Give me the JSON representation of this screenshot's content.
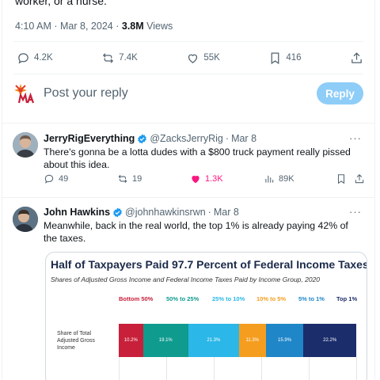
{
  "tweet": {
    "text_tail": "worker, or a nurse.",
    "time": "4:10 AM",
    "date": "Mar 8, 2024",
    "views_count": "3.8M",
    "views_label": "Views",
    "stats": {
      "replies": "4.2K",
      "retweets": "7.4K",
      "likes": "55K",
      "bookmarks": "416"
    }
  },
  "compose": {
    "placeholder": "Post your reply",
    "reply_button": "Reply"
  },
  "replies": [
    {
      "name": "JerryRigEverything",
      "handle": "@ZacksJerryRig",
      "date": "Mar 8",
      "text": "There's gonna be a lotta dudes with a $800 truck payment really pissed about this idea.",
      "replies": "49",
      "retweets": "19",
      "likes": "1.3K",
      "views": "89K"
    },
    {
      "name": "John Hawkins",
      "handle": "@johnhawkinsrwn",
      "date": "Mar 8",
      "text": "Meanwhile, back in the real world, the top 1% is already paying 42% of the taxes."
    }
  ],
  "separator": "·",
  "more_label": "···",
  "chart_data": {
    "type": "bar",
    "title": "Half of Taxpayers Paid 97.7 Percent of Federal Income Taxes",
    "subtitle": "Shares of Adjusted Gross Income and Federal Income Taxes Paid by Income Group, 2020",
    "row_label": "Share of Total Adjusted Gross Income",
    "categories": [
      "Bottom 50%",
      "50% to 25%",
      "25% to 10%",
      "10% to 5%",
      "5% to 1%",
      "Top 1%"
    ],
    "colors": [
      "#c8203a",
      "#0f9b8e",
      "#2bb7e8",
      "#f59d1f",
      "#1f86c8",
      "#1b2d6b"
    ],
    "values": [
      10.2,
      19.1,
      21.3,
      11.3,
      15.9,
      22.2
    ],
    "value_labels": [
      "10.2%",
      "19.1%",
      "21.3%",
      "11.3%",
      "15.9%",
      "22.2%"
    ]
  }
}
